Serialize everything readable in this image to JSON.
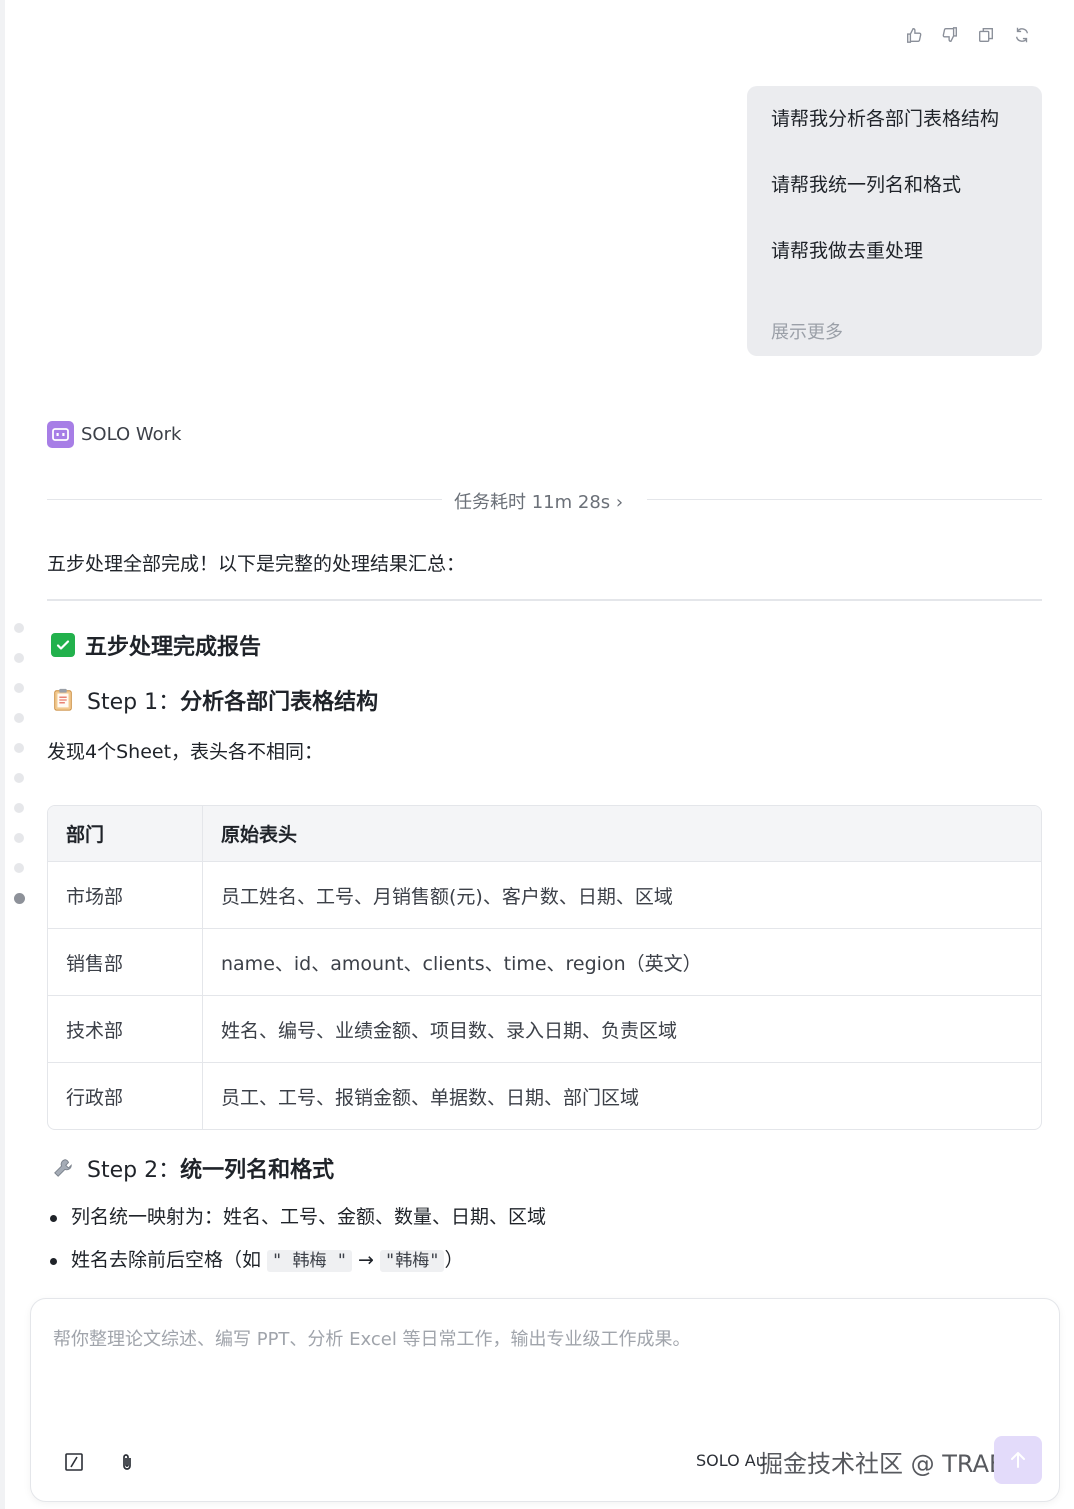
{
  "feedback": {
    "icons": [
      "thumbs-up-icon",
      "thumbs-down-icon",
      "copy-icon",
      "refresh-icon"
    ]
  },
  "user_message": {
    "lines": [
      "请帮我分析各部门表格结构",
      "请帮我统一列名和格式",
      "请帮我做去重处理"
    ],
    "show_more": "展示更多"
  },
  "agent": {
    "name": "SOLO Work",
    "duration": "任务耗时 11m 28s",
    "chevron": "›"
  },
  "response": {
    "intro": "五步处理全部完成！以下是完整的处理结果汇总：",
    "report_title": "五步处理完成报告",
    "step1": {
      "prefix": "Step 1：",
      "title": "分析各部门表格结构",
      "desc": "发现4个Sheet，表头各不相同："
    },
    "table": {
      "headers": [
        "部门",
        "原始表头"
      ],
      "rows": [
        [
          "市场部",
          "员工姓名、工号、月销售额(元)、客户数、日期、区域"
        ],
        [
          "销售部",
          "name、id、amount、clients、time、region（英文）"
        ],
        [
          "技术部",
          "姓名、编号、业绩金额、项目数、录入日期、负责区域"
        ],
        [
          "行政部",
          "员工、工号、报销金额、单据数、日期、部门区域"
        ]
      ]
    },
    "step2": {
      "prefix": "Step 2：",
      "title": "统一列名和格式",
      "bullet1": "列名统一映射为：姓名、工号、金额、数量、日期、区域",
      "bullet2_a": "姓名去除前后空格（如 ",
      "bullet2_code1": "\" 韩梅 \"",
      "bullet2_arrow": " → ",
      "bullet2_code2": "\"韩梅\"",
      "bullet2_b": "）"
    }
  },
  "composer": {
    "placeholder": "帮你整理论文综述、编写 PPT、分析 Excel 等日常工作，输出专业级工作成果。",
    "mode": "SOLO Au",
    "watermark": "掘金技术社区 @ TRAE_ai"
  },
  "colors": {
    "accent": "#a77ee6",
    "send_bg": "#e3dbfa",
    "check_green": "#22b14c"
  }
}
